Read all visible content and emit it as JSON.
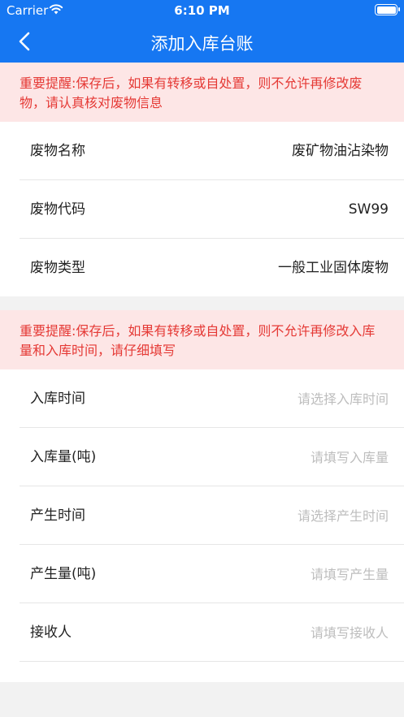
{
  "status_bar": {
    "carrier": "Carrier",
    "time": "6:10 PM"
  },
  "nav": {
    "title": "添加入库台账"
  },
  "alerts": [
    "重要提醒:保存后，如果有转移或自处置，则不允许再修改废物，请认真核对废物信息",
    "重要提醒:保存后，如果有转移或自处置，则不允许再修改入库量和入库时间，请仔细填写"
  ],
  "waste_info": [
    {
      "label": "废物名称",
      "value": "废矿物油沾染物"
    },
    {
      "label": "废物代码",
      "value": "SW99"
    },
    {
      "label": "废物类型",
      "value": "一般工业固体废物"
    }
  ],
  "form": [
    {
      "label": "入库时间",
      "placeholder": "请选择入库时间"
    },
    {
      "label": "入库量(吨)",
      "placeholder": "请填写入库量"
    },
    {
      "label": "产生时间",
      "placeholder": "请选择产生时间"
    },
    {
      "label": "产生量(吨)",
      "placeholder": "请填写产生量"
    },
    {
      "label": "接收人",
      "placeholder": "请填写接收人"
    }
  ],
  "colors": {
    "primary": "#1677f2",
    "alert_bg": "#fde6e6",
    "alert_text": "#e53935",
    "placeholder": "#bdbdbd"
  }
}
